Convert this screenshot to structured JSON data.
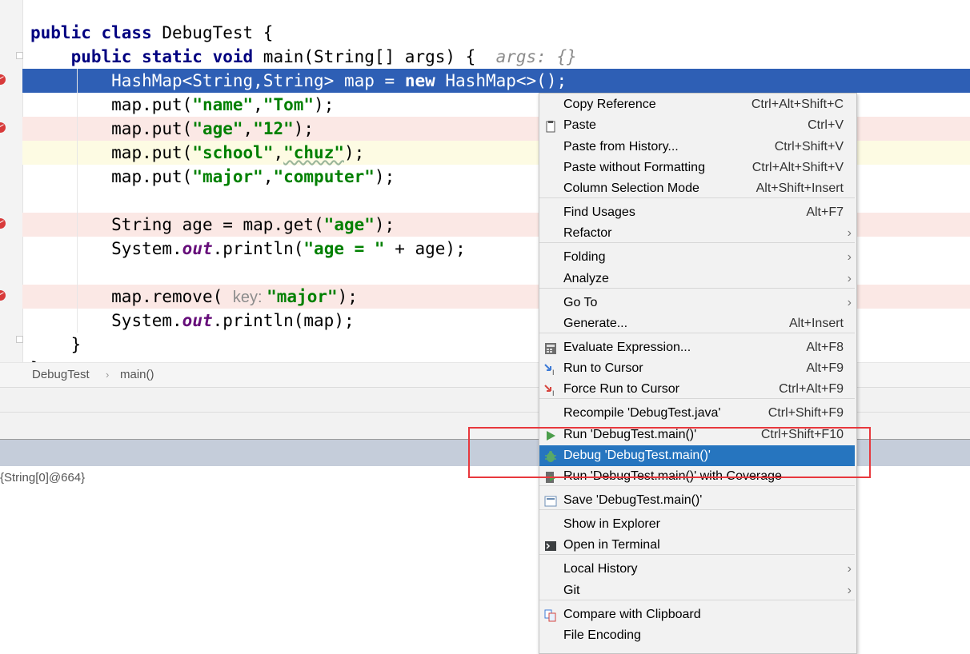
{
  "editor": {
    "lines": [
      {
        "indent": "",
        "segments": [
          {
            "t": "public class ",
            "c": "kw"
          },
          {
            "t": "DebugTest {",
            "c": ""
          }
        ]
      },
      {
        "indent": "    ",
        "segments": [
          {
            "t": "public static void ",
            "c": "kw"
          },
          {
            "t": "main(String[] args) {  ",
            "c": ""
          },
          {
            "t": "args: {}",
            "c": "inlinehint"
          }
        ]
      },
      {
        "indent": "        ",
        "segments": [
          {
            "t": "HashMap<String,String> map = ",
            "c": ""
          },
          {
            "t": "new ",
            "c": "kw"
          },
          {
            "t": "HashMap<>();",
            "c": ""
          }
        ]
      },
      {
        "indent": "        ",
        "segments": [
          {
            "t": "map.put(",
            "c": ""
          },
          {
            "t": "\"name\"",
            "c": "str"
          },
          {
            "t": ",",
            "c": ""
          },
          {
            "t": "\"Tom\"",
            "c": "str"
          },
          {
            "t": ");",
            "c": ""
          }
        ]
      },
      {
        "indent": "        ",
        "segments": [
          {
            "t": "map.put(",
            "c": ""
          },
          {
            "t": "\"age\"",
            "c": "str"
          },
          {
            "t": ",",
            "c": ""
          },
          {
            "t": "\"12\"",
            "c": "str"
          },
          {
            "t": ");",
            "c": ""
          }
        ]
      },
      {
        "indent": "        ",
        "segments": [
          {
            "t": "map.put(",
            "c": ""
          },
          {
            "t": "\"school\"",
            "c": "str"
          },
          {
            "t": ",",
            "c": ""
          },
          {
            "t": "\"chuz\"",
            "c": "str squig"
          },
          {
            "t": ");",
            "c": ""
          }
        ]
      },
      {
        "indent": "        ",
        "segments": [
          {
            "t": "map.put(",
            "c": ""
          },
          {
            "t": "\"major\"",
            "c": "str"
          },
          {
            "t": ",",
            "c": ""
          },
          {
            "t": "\"computer\"",
            "c": "str"
          },
          {
            "t": ");",
            "c": ""
          }
        ]
      },
      {
        "indent": "",
        "segments": []
      },
      {
        "indent": "        ",
        "segments": [
          {
            "t": "String age = map.get(",
            "c": ""
          },
          {
            "t": "\"age\"",
            "c": "str"
          },
          {
            "t": ");",
            "c": ""
          }
        ]
      },
      {
        "indent": "        ",
        "segments": [
          {
            "t": "System.",
            "c": ""
          },
          {
            "t": "out",
            "c": "fld"
          },
          {
            "t": ".println(",
            "c": ""
          },
          {
            "t": "\"age = \"",
            "c": "str"
          },
          {
            "t": " + age);",
            "c": ""
          }
        ]
      },
      {
        "indent": "",
        "segments": []
      },
      {
        "indent": "        ",
        "segments": [
          {
            "t": "map.remove( ",
            "c": ""
          },
          {
            "t": "key: ",
            "c": "hint"
          },
          {
            "t": "\"major\"",
            "c": "str"
          },
          {
            "t": ");",
            "c": ""
          }
        ]
      },
      {
        "indent": "        ",
        "segments": [
          {
            "t": "System.",
            "c": ""
          },
          {
            "t": "out",
            "c": "fld"
          },
          {
            "t": ".println(map);",
            "c": ""
          }
        ]
      },
      {
        "indent": "    ",
        "segments": [
          {
            "t": "}",
            "c": ""
          }
        ]
      },
      {
        "indent": "",
        "segments": [
          {
            "t": "}",
            "c": ""
          }
        ]
      }
    ]
  },
  "breadcrumb": {
    "class_name": "DebugTest",
    "method_name": "main()"
  },
  "variables": {
    "args_value": "{String[0]@664}"
  },
  "context_menu": {
    "items": [
      {
        "label": "Copy Reference",
        "shortcut": "Ctrl+Alt+Shift+C"
      },
      {
        "label": "Paste",
        "shortcut": "Ctrl+V",
        "icon": "clipboard-icon"
      },
      {
        "label": "Paste from History...",
        "shortcut": "Ctrl+Shift+V"
      },
      {
        "label": "Paste without Formatting",
        "shortcut": "Ctrl+Alt+Shift+V"
      },
      {
        "label": "Column Selection Mode",
        "shortcut": "Alt+Shift+Insert"
      },
      {
        "label": "Find Usages",
        "shortcut": "Alt+F7"
      },
      {
        "label": "Refactor",
        "submenu": true
      },
      {
        "label": "Folding",
        "submenu": true
      },
      {
        "label": "Analyze",
        "submenu": true
      },
      {
        "label": "Go To",
        "submenu": true
      },
      {
        "label": "Generate...",
        "shortcut": "Alt+Insert"
      },
      {
        "label": "Evaluate Expression...",
        "shortcut": "Alt+F8",
        "icon": "calculator-icon"
      },
      {
        "label": "Run to Cursor",
        "shortcut": "Alt+F9",
        "icon": "run-to-cursor-icon"
      },
      {
        "label": "Force Run to Cursor",
        "shortcut": "Ctrl+Alt+F9",
        "icon": "force-run-to-cursor-icon"
      },
      {
        "label": "Recompile 'DebugTest.java'",
        "shortcut": "Ctrl+Shift+F9"
      },
      {
        "label": "Run 'DebugTest.main()'",
        "shortcut": "Ctrl+Shift+F10",
        "icon": "run-icon"
      },
      {
        "label": "Debug 'DebugTest.main()'",
        "selected": true,
        "icon": "debug-bug-icon"
      },
      {
        "label": "Run 'DebugTest.main()' with Coverage",
        "icon": "coverage-icon"
      },
      {
        "label": "Save 'DebugTest.main()'",
        "icon": "save-config-icon"
      },
      {
        "label": "Show in Explorer"
      },
      {
        "label": "Open in Terminal",
        "icon": "terminal-icon"
      },
      {
        "label": "Local History",
        "submenu": true
      },
      {
        "label": "Git",
        "submenu": true
      },
      {
        "label": "Compare with Clipboard",
        "icon": "compare-icon"
      },
      {
        "label": "File Encoding"
      }
    ]
  },
  "colors": {
    "execution_line": "#2e5fb5",
    "breakpoint_line": "#fbe8e5",
    "menu_selection": "#2675bf",
    "highlight_box": "#e8383d",
    "keyword": "#000080",
    "string": "#008000"
  }
}
